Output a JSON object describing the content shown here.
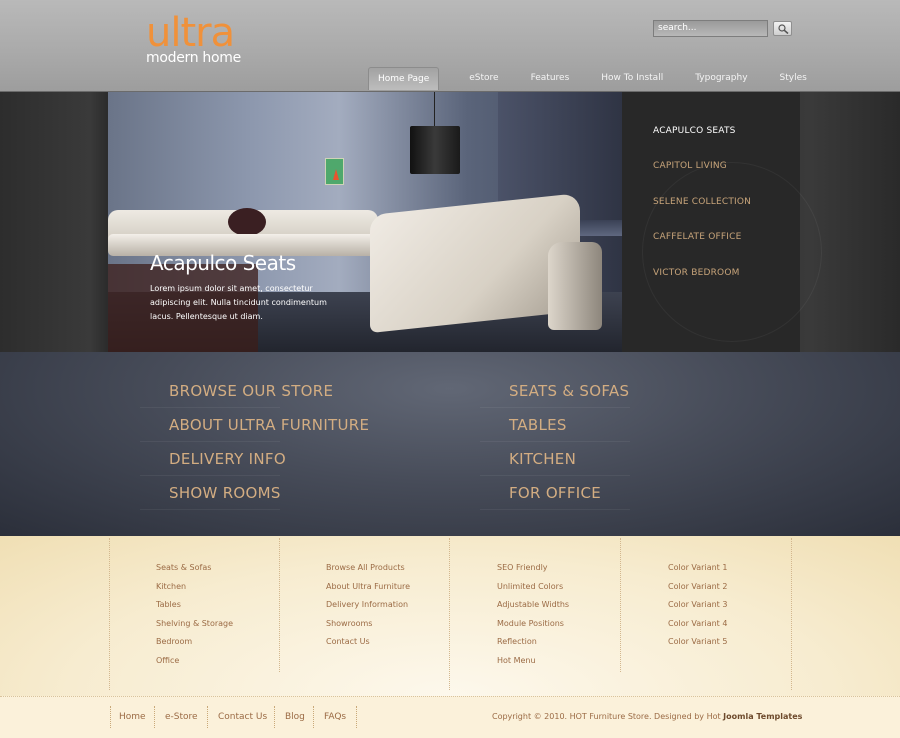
{
  "header": {
    "logo_main": "ultra",
    "logo_sub": "modern home",
    "search_placeholder": "search...",
    "nav": [
      "Home Page",
      "eStore",
      "Features",
      "How To Install",
      "Typography",
      "Styles"
    ]
  },
  "hero": {
    "title": "Acapulco Seats",
    "text": "Lorem ipsum dolor sit amet, consectetur adipiscing elit. Nulla tincidunt condimentum lacus. Pellentesque ut diam.",
    "slides": [
      "ACAPULCO SEATS",
      "CAPITOL LIVING",
      "SELENE COLLECTION",
      "CAFFELATE OFFICE",
      "VICTOR BEDROOM"
    ]
  },
  "links": {
    "left": [
      "BROWSE OUR STORE",
      "ABOUT ULTRA FURNITURE",
      "DELIVERY INFO",
      "SHOW ROOMS"
    ],
    "right": [
      "SEATS & SOFAS",
      "TABLES",
      "KITCHEN",
      "FOR OFFICE"
    ]
  },
  "footer": {
    "col1": [
      "Seats & Sofas",
      "Kitchen",
      "Tables",
      "Shelving & Storage",
      "Bedroom",
      "Office"
    ],
    "col2": [
      "Browse All Products",
      "About Ultra Furniture",
      "Delivery Information",
      "Showrooms",
      "Contact Us"
    ],
    "col3": [
      "SEO Friendly",
      "Unlimited Colors",
      "Adjustable Widths",
      "Module Positions",
      "Reflection",
      "Hot Menu"
    ],
    "col4": [
      "Color Variant 1",
      "Color Variant 2",
      "Color Variant 3",
      "Color Variant 4",
      "Color Variant 5"
    ]
  },
  "bottom": {
    "links": [
      "Home",
      "e-Store",
      "Contact Us",
      "Blog",
      "FAQs"
    ],
    "copyright": "Copyright © 2010. HOT Furniture Store. Designed by Hot",
    "copyright_brand": "Joomla Templates"
  },
  "colors": {
    "logo_accent": "#f0913a",
    "link_gold": "#d3ad82",
    "footer_link": "#9b6b45"
  }
}
